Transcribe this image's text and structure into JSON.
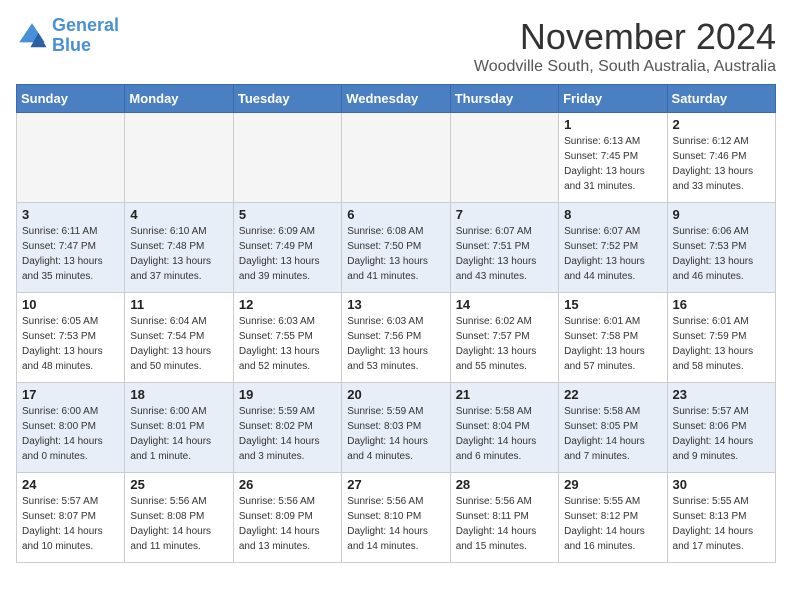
{
  "header": {
    "logo_line1": "General",
    "logo_line2": "Blue",
    "month": "November 2024",
    "location": "Woodville South, South Australia, Australia"
  },
  "weekdays": [
    "Sunday",
    "Monday",
    "Tuesday",
    "Wednesday",
    "Thursday",
    "Friday",
    "Saturday"
  ],
  "rows": [
    [
      {
        "day": "",
        "info": ""
      },
      {
        "day": "",
        "info": ""
      },
      {
        "day": "",
        "info": ""
      },
      {
        "day": "",
        "info": ""
      },
      {
        "day": "",
        "info": ""
      },
      {
        "day": "1",
        "info": "Sunrise: 6:13 AM\nSunset: 7:45 PM\nDaylight: 13 hours\nand 31 minutes."
      },
      {
        "day": "2",
        "info": "Sunrise: 6:12 AM\nSunset: 7:46 PM\nDaylight: 13 hours\nand 33 minutes."
      }
    ],
    [
      {
        "day": "3",
        "info": "Sunrise: 6:11 AM\nSunset: 7:47 PM\nDaylight: 13 hours\nand 35 minutes."
      },
      {
        "day": "4",
        "info": "Sunrise: 6:10 AM\nSunset: 7:48 PM\nDaylight: 13 hours\nand 37 minutes."
      },
      {
        "day": "5",
        "info": "Sunrise: 6:09 AM\nSunset: 7:49 PM\nDaylight: 13 hours\nand 39 minutes."
      },
      {
        "day": "6",
        "info": "Sunrise: 6:08 AM\nSunset: 7:50 PM\nDaylight: 13 hours\nand 41 minutes."
      },
      {
        "day": "7",
        "info": "Sunrise: 6:07 AM\nSunset: 7:51 PM\nDaylight: 13 hours\nand 43 minutes."
      },
      {
        "day": "8",
        "info": "Sunrise: 6:07 AM\nSunset: 7:52 PM\nDaylight: 13 hours\nand 44 minutes."
      },
      {
        "day": "9",
        "info": "Sunrise: 6:06 AM\nSunset: 7:53 PM\nDaylight: 13 hours\nand 46 minutes."
      }
    ],
    [
      {
        "day": "10",
        "info": "Sunrise: 6:05 AM\nSunset: 7:53 PM\nDaylight: 13 hours\nand 48 minutes."
      },
      {
        "day": "11",
        "info": "Sunrise: 6:04 AM\nSunset: 7:54 PM\nDaylight: 13 hours\nand 50 minutes."
      },
      {
        "day": "12",
        "info": "Sunrise: 6:03 AM\nSunset: 7:55 PM\nDaylight: 13 hours\nand 52 minutes."
      },
      {
        "day": "13",
        "info": "Sunrise: 6:03 AM\nSunset: 7:56 PM\nDaylight: 13 hours\nand 53 minutes."
      },
      {
        "day": "14",
        "info": "Sunrise: 6:02 AM\nSunset: 7:57 PM\nDaylight: 13 hours\nand 55 minutes."
      },
      {
        "day": "15",
        "info": "Sunrise: 6:01 AM\nSunset: 7:58 PM\nDaylight: 13 hours\nand 57 minutes."
      },
      {
        "day": "16",
        "info": "Sunrise: 6:01 AM\nSunset: 7:59 PM\nDaylight: 13 hours\nand 58 minutes."
      }
    ],
    [
      {
        "day": "17",
        "info": "Sunrise: 6:00 AM\nSunset: 8:00 PM\nDaylight: 14 hours\nand 0 minutes."
      },
      {
        "day": "18",
        "info": "Sunrise: 6:00 AM\nSunset: 8:01 PM\nDaylight: 14 hours\nand 1 minute."
      },
      {
        "day": "19",
        "info": "Sunrise: 5:59 AM\nSunset: 8:02 PM\nDaylight: 14 hours\nand 3 minutes."
      },
      {
        "day": "20",
        "info": "Sunrise: 5:59 AM\nSunset: 8:03 PM\nDaylight: 14 hours\nand 4 minutes."
      },
      {
        "day": "21",
        "info": "Sunrise: 5:58 AM\nSunset: 8:04 PM\nDaylight: 14 hours\nand 6 minutes."
      },
      {
        "day": "22",
        "info": "Sunrise: 5:58 AM\nSunset: 8:05 PM\nDaylight: 14 hours\nand 7 minutes."
      },
      {
        "day": "23",
        "info": "Sunrise: 5:57 AM\nSunset: 8:06 PM\nDaylight: 14 hours\nand 9 minutes."
      }
    ],
    [
      {
        "day": "24",
        "info": "Sunrise: 5:57 AM\nSunset: 8:07 PM\nDaylight: 14 hours\nand 10 minutes."
      },
      {
        "day": "25",
        "info": "Sunrise: 5:56 AM\nSunset: 8:08 PM\nDaylight: 14 hours\nand 11 minutes."
      },
      {
        "day": "26",
        "info": "Sunrise: 5:56 AM\nSunset: 8:09 PM\nDaylight: 14 hours\nand 13 minutes."
      },
      {
        "day": "27",
        "info": "Sunrise: 5:56 AM\nSunset: 8:10 PM\nDaylight: 14 hours\nand 14 minutes."
      },
      {
        "day": "28",
        "info": "Sunrise: 5:56 AM\nSunset: 8:11 PM\nDaylight: 14 hours\nand 15 minutes."
      },
      {
        "day": "29",
        "info": "Sunrise: 5:55 AM\nSunset: 8:12 PM\nDaylight: 14 hours\nand 16 minutes."
      },
      {
        "day": "30",
        "info": "Sunrise: 5:55 AM\nSunset: 8:13 PM\nDaylight: 14 hours\nand 17 minutes."
      }
    ]
  ],
  "alt_rows": [
    1,
    3
  ]
}
